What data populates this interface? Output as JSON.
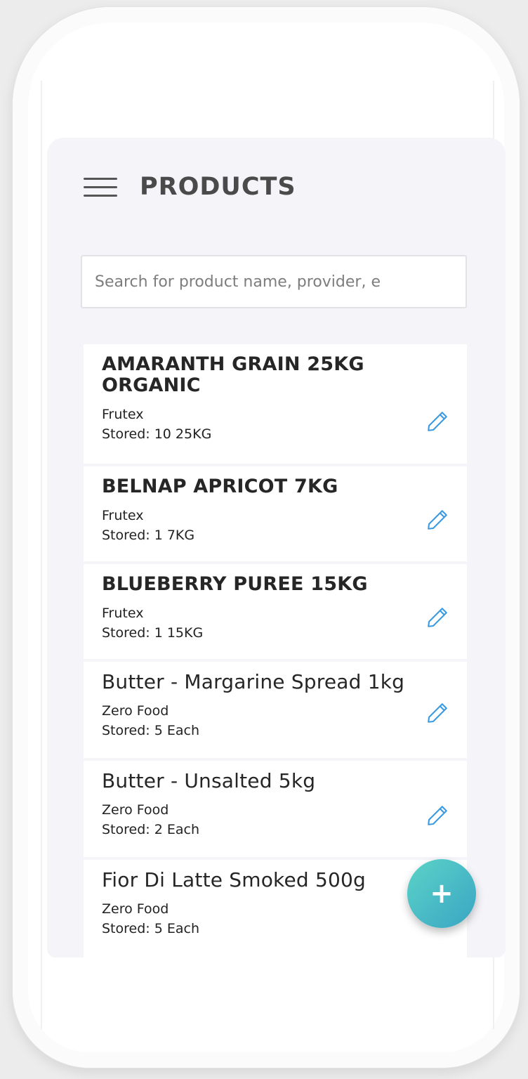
{
  "header": {
    "title": "PRODUCTS"
  },
  "search": {
    "placeholder": "Search for product name, provider, e"
  },
  "products": [
    {
      "name": "AMARANTH GRAIN 25KG ORGANIC",
      "provider": "Frutex",
      "stored": "Stored: 10 25KG"
    },
    {
      "name": "BELNAP APRICOT 7KG",
      "provider": "Frutex",
      "stored": "Stored: 1 7KG"
    },
    {
      "name": "BLUEBERRY PUREE 15KG",
      "provider": "Frutex",
      "stored": "Stored: 1 15KG"
    },
    {
      "name": "Butter - Margarine Spread 1kg",
      "provider": "Zero Food",
      "stored": "Stored: 5 Each"
    },
    {
      "name": "Butter - Unsalted 5kg",
      "provider": "Zero Food",
      "stored": "Stored: 2 Each"
    },
    {
      "name": "Fior Di Latte Smoked 500g",
      "provider": "Zero Food",
      "stored": "Stored: 5 Each"
    }
  ],
  "fab": {
    "label": "+",
    "icon": "plus-icon"
  },
  "colors": {
    "edit_icon": "#3b9ae0",
    "fab_start": "#5bd3c7",
    "fab_end": "#3aa5c4",
    "screen_bg": "#f4f4f9"
  }
}
